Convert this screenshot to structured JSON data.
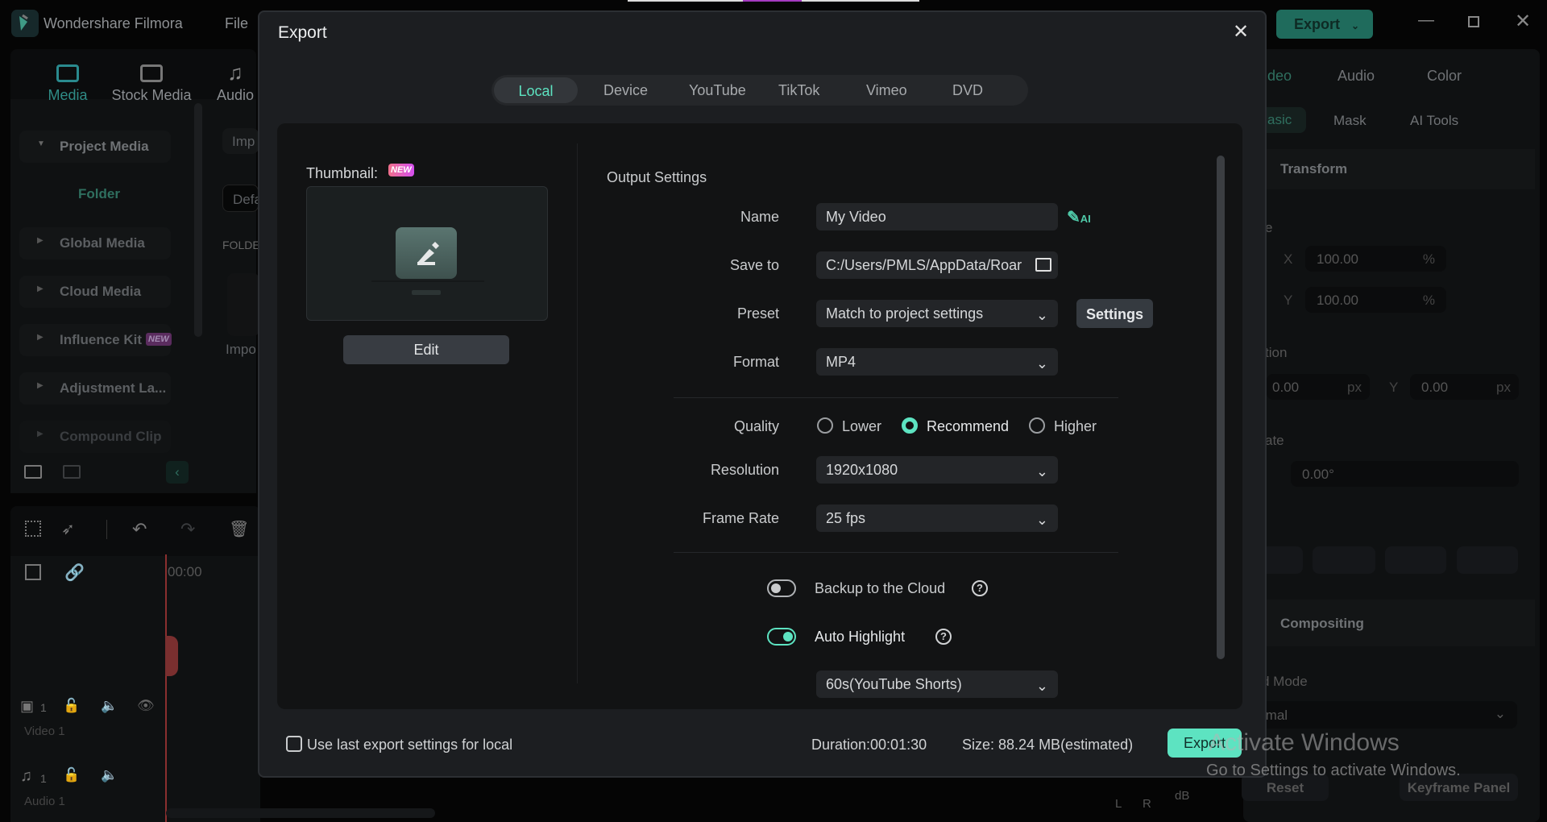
{
  "app": {
    "title": "Wondershare Filmora",
    "menu_file": "File",
    "export_label": "Export"
  },
  "media_tabs": [
    {
      "label": "Media",
      "icon": "media-icon"
    },
    {
      "label": "Stock Media",
      "icon": "cloud-folder-icon"
    },
    {
      "label": "Audio",
      "icon": "music-note-icon"
    }
  ],
  "sidebar": {
    "items": [
      {
        "label": "Project Media",
        "expanded": true
      },
      {
        "label": "Folder"
      },
      {
        "label": "Global Media"
      },
      {
        "label": "Cloud Media"
      },
      {
        "label": "Influence Kit",
        "badge": "NEW"
      },
      {
        "label": "Adjustment La..."
      },
      {
        "label": "Compound Clip"
      }
    ]
  },
  "library": {
    "import_partial": "Imp",
    "default_partial": "Defa",
    "folder_partial": "FOLDE",
    "import_caption_partial": "Impo"
  },
  "timeline": {
    "timecode": "00:00",
    "tracks": [
      {
        "label": "Video 1",
        "index": "1"
      },
      {
        "label": "Audio 1",
        "index": "1"
      }
    ],
    "meter": {
      "left": "L",
      "right": "R",
      "unit": "dB"
    }
  },
  "properties": {
    "tabs": [
      "Video",
      "Audio",
      "Color"
    ],
    "active_tab": "Video",
    "video_partial": "deo",
    "subtabs": [
      "Basic",
      "Mask",
      "AI Tools"
    ],
    "basic_partial": "asic",
    "transform": "Transform",
    "scale_partial": "e",
    "scale_x": "100.00",
    "scale_y": "100.00",
    "percent": "%",
    "position_partial": "tion",
    "pos_x": "0.00",
    "pos_y": "0.00",
    "px": "px",
    "x": "X",
    "y": "Y",
    "rotate_partial": "ate",
    "rotate": "0.00°",
    "compositing": "Compositing",
    "blend_mode_partial": "d Mode",
    "blend_value_partial": "rmal",
    "reset": "Reset",
    "keyframe_panel": "Keyframe Panel"
  },
  "dialog": {
    "title": "Export",
    "tabs": [
      "Local",
      "Device",
      "YouTube",
      "TikTok",
      "Vimeo",
      "DVD"
    ],
    "active_tab": "Local",
    "thumbnail_label": "Thumbnail:",
    "thumbnail_badge": "NEW",
    "edit_label": "Edit",
    "output_settings": "Output Settings",
    "name_label": "Name",
    "name_value": "My Video",
    "save_label": "Save to",
    "save_value": "C:/Users/PMLS/AppData/Roar",
    "preset_label": "Preset",
    "preset_value": "Match to project settings",
    "settings_button": "Settings",
    "format_label": "Format",
    "format_value": "MP4",
    "quality_label": "Quality",
    "quality_options": [
      "Lower",
      "Recommend",
      "Higher"
    ],
    "quality_selected": "Recommend",
    "resolution_label": "Resolution",
    "resolution_value": "1920x1080",
    "framerate_label": "Frame Rate",
    "framerate_value": "25 fps",
    "backup_label": "Backup to the Cloud",
    "backup_on": false,
    "highlight_label": "Auto Highlight",
    "highlight_on": true,
    "highlight_value": "60s(YouTube Shorts)",
    "use_last_label": "Use last export settings for local",
    "use_last_checked": false,
    "duration": "Duration:00:01:30",
    "size": "Size: 88.24 MB(estimated)",
    "export_button": "Export"
  },
  "watermark": {
    "line1": "Activate Windows",
    "line2": "Go to Settings to activate Windows."
  },
  "colors": {
    "accent": "#5de3c1",
    "dialog_bg": "#1c1e21",
    "panel_bg": "#121314",
    "playhead": "#a33a3a"
  }
}
